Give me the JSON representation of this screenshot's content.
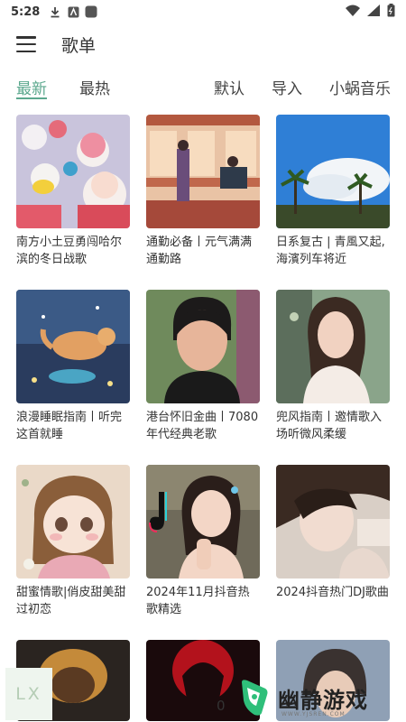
{
  "statusbar": {
    "time": "5:28"
  },
  "appbar": {
    "title": "歌单"
  },
  "tabs": {
    "newest": "最新",
    "hottest": "最热",
    "default": "默认",
    "import": "导入",
    "source": "小蜗音乐",
    "active": "newest"
  },
  "playlists": [
    {
      "title": "南方小土豆勇闯哈尔滨的冬日战歌"
    },
    {
      "title": "通勤必备丨元气满满通勤路"
    },
    {
      "title": "日系复古 | 青風又起, 海濱列车将近"
    },
    {
      "title": "浪漫睡眠指南丨听完这首就睡"
    },
    {
      "title": "港台怀旧金曲丨7080年代经典老歌"
    },
    {
      "title": "兜风指南丨邀情歌入场听微风柔缓"
    },
    {
      "title": "甜蜜情歌|俏皮甜美甜过初恋"
    },
    {
      "title": "2024年11月抖音热歌精选"
    },
    {
      "title": "2024抖音热门DJ歌曲"
    }
  ],
  "overlay": {
    "lx_badge": "LX",
    "page_counter": "0",
    "watermark": "幽静游戏",
    "watermark_sub": "WWW.YJSREN.COM"
  },
  "colors": {
    "accent": "#5ca88e"
  }
}
